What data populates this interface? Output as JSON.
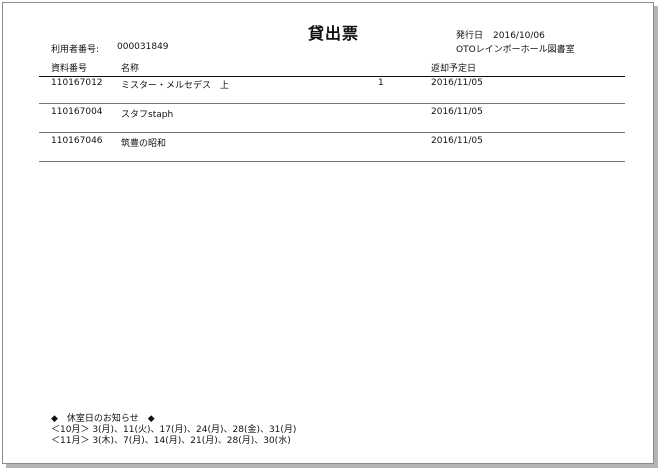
{
  "document": {
    "title": "貸出票",
    "issue_label": "発行日",
    "issue_date": "2016/10/06",
    "library": "OTOレインボーホール図書室",
    "user_label": "利用者番号:",
    "user_number": "000031849"
  },
  "table": {
    "headers": {
      "id": "資料番号",
      "name": "名称",
      "due": "返却予定日"
    },
    "rows": [
      {
        "id": "110167012",
        "name": "ミスター・メルセデス　上",
        "qty": "1",
        "due": "2016/11/05"
      },
      {
        "id": "110167004",
        "name": "スタフstaph",
        "qty": "",
        "due": "2016/11/05"
      },
      {
        "id": "110167046",
        "name": "筑豊の昭和",
        "qty": "",
        "due": "2016/11/05"
      }
    ]
  },
  "notice": {
    "heading": "◆　休室日のお知らせ　◆",
    "lines": [
      "＜10月＞ 3(月)、11(火)、17(月)、24(月)、28(金)、31(月)",
      "＜11月＞ 3(木)、7(月)、14(月)、21(月)、28(月)、30(水)"
    ]
  }
}
